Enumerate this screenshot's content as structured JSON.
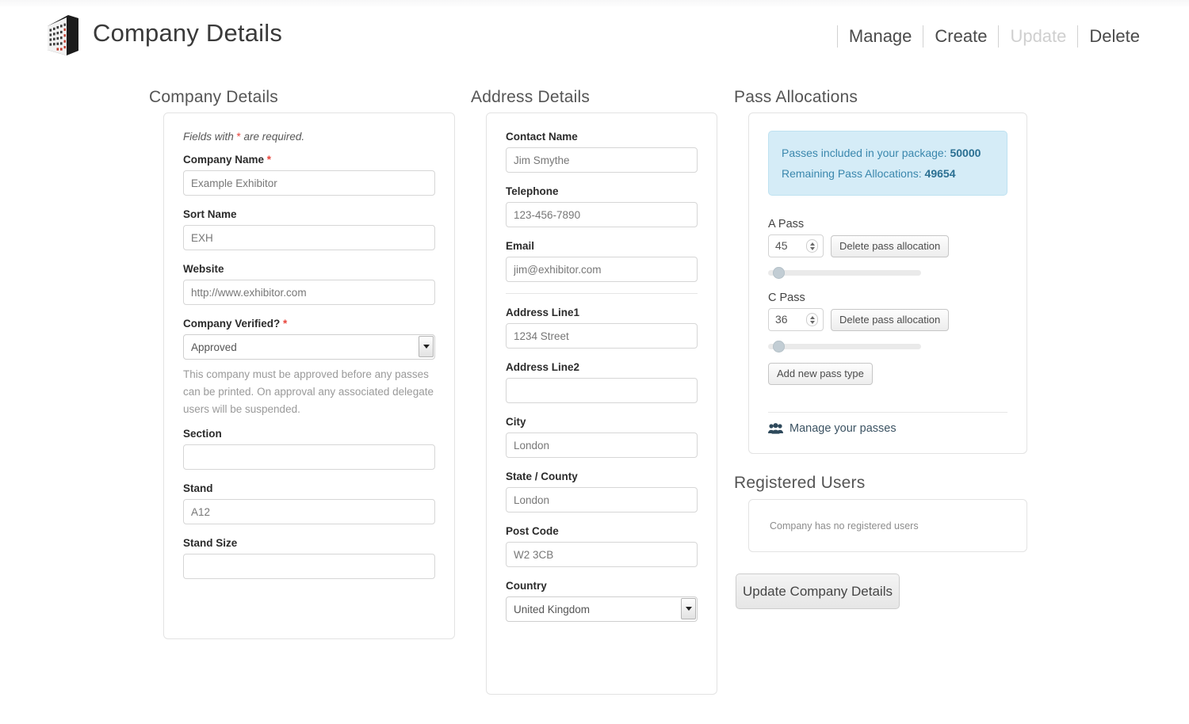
{
  "header": {
    "title": "Company Details",
    "logo_icon": "building-logo-icon",
    "nav": [
      {
        "label": "Manage",
        "disabled": false
      },
      {
        "label": "Create",
        "disabled": false
      },
      {
        "label": "Update",
        "disabled": true
      },
      {
        "label": "Delete",
        "disabled": false
      }
    ]
  },
  "company": {
    "heading": "Company Details",
    "required_hint_pre": "Fields with ",
    "required_hint_star": "*",
    "required_hint_post": " are required.",
    "fields": {
      "company_name_label": "Company Name",
      "company_name_value": "Example Exhibitor",
      "sort_name_label": "Sort Name",
      "sort_name_value": "EXH",
      "website_label": "Website",
      "website_value": "http://www.exhibitor.com",
      "verified_label": "Company Verified?",
      "verified_value": "Approved",
      "verified_options": [
        "Approved"
      ],
      "verified_help": "This company must be approved before any passes can be printed. On approval any associated delegate users will be suspended.",
      "section_label": "Section",
      "section_value": "",
      "stand_label": "Stand",
      "stand_value": "A12",
      "stand_size_label": "Stand Size",
      "stand_size_value": ""
    }
  },
  "address": {
    "heading": "Address Details",
    "fields": {
      "contact_name_label": "Contact Name",
      "contact_name_value": "Jim Smythe",
      "telephone_label": "Telephone",
      "telephone_value": "123-456-7890",
      "email_label": "Email",
      "email_value": "jim@exhibitor.com",
      "address1_label": "Address Line1",
      "address1_value": "1234 Street",
      "address2_label": "Address Line2",
      "address2_value": "",
      "city_label": "City",
      "city_value": "London",
      "state_label": "State / County",
      "state_value": "London",
      "postcode_label": "Post Code",
      "postcode_value": "W2 3CB",
      "country_label": "Country",
      "country_value": "United Kingdom",
      "country_options": [
        "United Kingdom"
      ]
    }
  },
  "passes": {
    "heading": "Pass Allocations",
    "alert": {
      "included_label": "Passes included in your package:",
      "included_value": "50000",
      "remaining_label": "Remaining Pass Allocations:",
      "remaining_value": "49654",
      "bg_color": "#d5ecf7",
      "text_color": "#3a87ad"
    },
    "allocations": [
      {
        "label": "A Pass",
        "value": "45",
        "delete_label": "Delete pass allocation",
        "slider_percent": 3
      },
      {
        "label": "C Pass",
        "value": "36",
        "delete_label": "Delete pass allocation",
        "slider_percent": 3
      }
    ],
    "add_label": "Add new pass type",
    "manage_link_label": "Manage your passes",
    "manage_link_icon": "users-group-icon"
  },
  "registered_users": {
    "heading": "Registered Users",
    "empty_message": "Company has no registered users"
  },
  "submit": {
    "label": "Update Company Details"
  }
}
